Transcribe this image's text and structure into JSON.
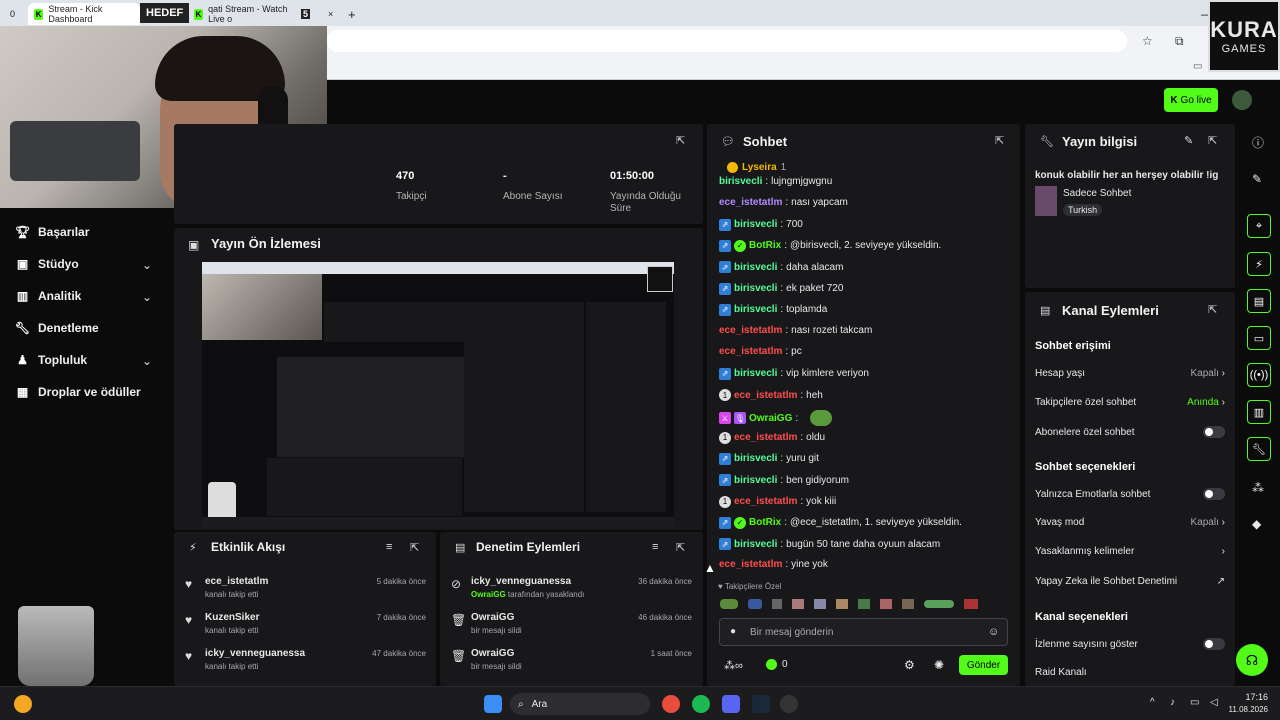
{
  "browser": {
    "tab_counter": "0",
    "tabs": [
      {
        "label": "Stream - Kick Dashboard"
      },
      {
        "label": "HEDEF"
      },
      {
        "label": "qati Stream - Watch Live o"
      }
    ],
    "tab_badge": "5",
    "new_tab": "+"
  },
  "logo": {
    "line1": "KURA",
    "line2": "GAMES"
  },
  "header": {
    "go_live": "Go live"
  },
  "sidebar": {
    "items": [
      {
        "label": "Başarılar",
        "icon": "trophy-icon"
      },
      {
        "label": "Stüdyo",
        "icon": "studio-icon"
      },
      {
        "label": "Analitik",
        "icon": "chart-icon"
      },
      {
        "label": "Denetleme",
        "icon": "wrench-icon"
      },
      {
        "label": "Topluluk",
        "icon": "community-icon"
      },
      {
        "label": "Droplar ve ödüller",
        "icon": "gift-icon"
      }
    ]
  },
  "stats": [
    {
      "value": "470",
      "label": "Takipçi"
    },
    {
      "value": "-",
      "label": "Abone Sayısı"
    },
    {
      "value": "01:50:00",
      "label": "Yayında Olduğu Süre"
    }
  ],
  "preview": {
    "title": "Yayın Ön İzlemesi"
  },
  "activity": {
    "title": "Etkinlik Akışı",
    "items": [
      {
        "user": "ece_istetatlm",
        "action": "kanalı takip etti",
        "time": "5 dakika önce"
      },
      {
        "user": "KuzenSiker",
        "action": "kanalı takip etti",
        "time": "7 dakika önce"
      },
      {
        "user": "icky_venneguanessa",
        "action": "kanalı takip etti",
        "time": "47 dakika önce"
      }
    ]
  },
  "moderation": {
    "title": "Denetim Eylemleri",
    "items": [
      {
        "user": "icky_venneguanessa",
        "detail_user": "OwraiGG",
        "detail": " tarafından yasaklandı",
        "time": "36 dakika önce"
      },
      {
        "user": "OwraiGG",
        "detail_user": "",
        "detail": "bir mesajı sildi",
        "time": "46 dakika önce"
      },
      {
        "user": "OwraiGG",
        "detail_user": "",
        "detail": "bir mesajı sildi",
        "time": "1 saat önce"
      }
    ]
  },
  "chat": {
    "title": "Sohbet",
    "pinned_user": "Lyseira",
    "pinned_count": "1",
    "lines": [
      {
        "user": "birisvecli",
        "color": "#53fc9a",
        "text": "lujngmjgwgnu",
        "badges": []
      },
      {
        "user": "ece_istetatlm",
        "color": "#b28cff",
        "text": "nası yapcam",
        "badges": []
      },
      {
        "user": "birisvecli",
        "color": "#53fc9a",
        "text": "700",
        "badges": [
          "sub"
        ]
      },
      {
        "user": "BotRix",
        "color": "#53fc18",
        "text": "@birisvecli, 2. seviyeye yükseldin.",
        "badges": [
          "sub",
          "verified"
        ]
      },
      {
        "user": "birisvecli",
        "color": "#53fc9a",
        "text": "daha alacam",
        "badges": [
          "sub"
        ]
      },
      {
        "user": "birisvecli",
        "color": "#53fc9a",
        "text": "ek paket 720",
        "badges": [
          "sub"
        ]
      },
      {
        "user": "birisvecli",
        "color": "#53fc9a",
        "text": "toplamda",
        "badges": [
          "sub"
        ]
      },
      {
        "user": "ece_istetatlm",
        "color": "#ff4d4d",
        "text": "nası rozeti takcam",
        "badges": []
      },
      {
        "user": "ece_istetatlm",
        "color": "#ff4d4d",
        "text": "pc",
        "badges": []
      },
      {
        "user": "birisvecli",
        "color": "#53fc9a",
        "text": "vip kimlere veriyon",
        "badges": [
          "sub"
        ]
      },
      {
        "user": "ece_istetatlm",
        "color": "#ff4d4d",
        "text": "heh",
        "badges": [
          "one"
        ]
      },
      {
        "user": "OwraiGG",
        "color": "#53fc18",
        "text": "",
        "badges": [
          "mod",
          "mic"
        ]
      },
      {
        "user": "ece_istetatlm",
        "color": "#ff4d4d",
        "text": "oldu",
        "badges": [
          "one"
        ]
      },
      {
        "user": "birisvecli",
        "color": "#53fc9a",
        "text": "yuru git",
        "badges": [
          "sub"
        ]
      },
      {
        "user": "birisvecli",
        "color": "#53fc9a",
        "text": "ben gidiyorum",
        "badges": [
          "sub"
        ]
      },
      {
        "user": "ece_istetatlm",
        "color": "#ff4d4d",
        "text": "yok kiii",
        "badges": [
          "one"
        ]
      },
      {
        "user": "BotRix",
        "color": "#53fc18",
        "text": "@ece_istetatlm, 1. seviyeye yükseldin.",
        "badges": [
          "sub",
          "verified"
        ]
      },
      {
        "user": "birisvecli",
        "color": "#53fc9a",
        "text": "bugün 50 tane daha oyuun alacam",
        "badges": [
          "sub"
        ]
      },
      {
        "user": "ece_istetatlm",
        "color": "#ff4d4d",
        "text": "yine yok",
        "badges": []
      }
    ],
    "followers_only": "Takipçilere Özel",
    "input_placeholder": "Bir mesaj gönderin",
    "points": "0",
    "send": "Gönder"
  },
  "stream_info": {
    "title": "Yayın bilgisi",
    "stream_title": "konuk olabilir her an herşey olabilir !ig",
    "category": "Sadece Sohbet",
    "tag": "Turkish"
  },
  "channel_actions": {
    "title": "Kanal Eylemleri",
    "sections": {
      "chat_access": "Sohbet erişimi",
      "chat_options": "Sohbet seçenekleri",
      "channel_options": "Kanal seçenekleri"
    },
    "rows": {
      "account_age": {
        "label": "Hesap yaşı",
        "value": "Kapalı"
      },
      "followers_chat": {
        "label": "Takipçilere özel sohbet",
        "value": "Anında"
      },
      "subs_chat": {
        "label": "Abonelere özel sohbet"
      },
      "emotes_only": {
        "label": "Yalnızca Emotlarla sohbet"
      },
      "slow_mode": {
        "label": "Yavaş mod",
        "value": "Kapalı"
      },
      "banned_words": {
        "label": "Yasaklanmış kelimeler"
      },
      "ai_moderation": {
        "label": "Yapay Zeka ile Sohbet Denetimi"
      },
      "show_viewers": {
        "label": "İzlenme sayısını göster"
      },
      "raid": {
        "label": "Raid Kanalı"
      }
    }
  },
  "taskbar": {
    "search": "Ara",
    "time": "17:16",
    "date": "11.08.2026"
  }
}
